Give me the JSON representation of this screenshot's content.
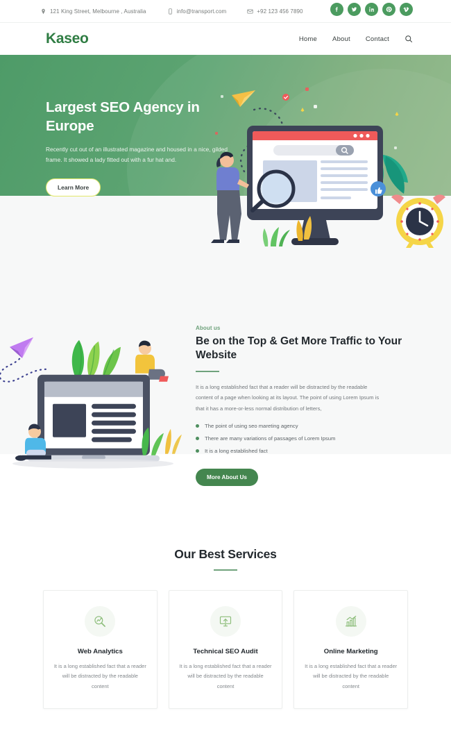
{
  "topbar": {
    "address": "121 King Street, Melbourne , Australia",
    "address_icon": "location-pin-icon",
    "email": "info@transport.com",
    "email_icon": "mobile-icon",
    "phone": "+92 123 456 7890",
    "phone_icon": "envelope-icon",
    "social": [
      {
        "name": "facebook",
        "glyph": "f"
      },
      {
        "name": "twitter",
        "glyph": "t"
      },
      {
        "name": "linkedin",
        "glyph": "in"
      },
      {
        "name": "pinterest",
        "glyph": "p"
      },
      {
        "name": "vimeo",
        "glyph": "v"
      }
    ],
    "social_color": "#4b9b5f"
  },
  "navbar": {
    "logo": "Kaseo",
    "logo_color": "#2f7d43",
    "links": [
      {
        "label": "Home"
      },
      {
        "label": "About"
      },
      {
        "label": "Contact"
      }
    ],
    "search_icon": "search-icon"
  },
  "hero": {
    "title": "Largest SEO Agency in Europe",
    "subtitle": "Recently cut out of an illustrated magazine and housed in a nice, gilded frame. It showed a lady fitted out with a fur hat and.",
    "button": "Learn More",
    "bg_from": "#4e9b68",
    "bg_to": "#93b98a",
    "button_border": "#e3e86a",
    "illustration": "seo-monitor-illustration"
  },
  "about": {
    "eyebrow": "About us",
    "title": "Be on the Top & Get More Traffic to Your Website",
    "paragraph": "It is a long established fact that a reader will be distracted by the readable content of a page when looking at its layout. The point of using Lorem Ipsum is that it has a more-or-less normal distribution of letters,",
    "bullets": [
      "The point of using seo mareting agency",
      "There are many variations of passages of Lorem Ipsum",
      "It is a long established fact"
    ],
    "button": "More About Us",
    "accent": "#6fa27c",
    "button_color": "#44864f",
    "illustration": "laptop-team-illustration"
  },
  "services": {
    "title": "Our Best Services",
    "accent": "#6fa27c",
    "cards": [
      {
        "icon": "analytics-magnifier-icon",
        "title": "Web Analytics",
        "desc": "It is a long established fact that a reader will be distracted by the readable content"
      },
      {
        "icon": "seo-audit-monitor-icon",
        "title": "Technical SEO Audit",
        "desc": "It is a long established fact that a reader will be distracted by the readable content"
      },
      {
        "icon": "bar-chart-growth-icon",
        "title": "Online Marketing",
        "desc": "It is a long established fact that a reader will be distracted by the readable content"
      }
    ]
  }
}
